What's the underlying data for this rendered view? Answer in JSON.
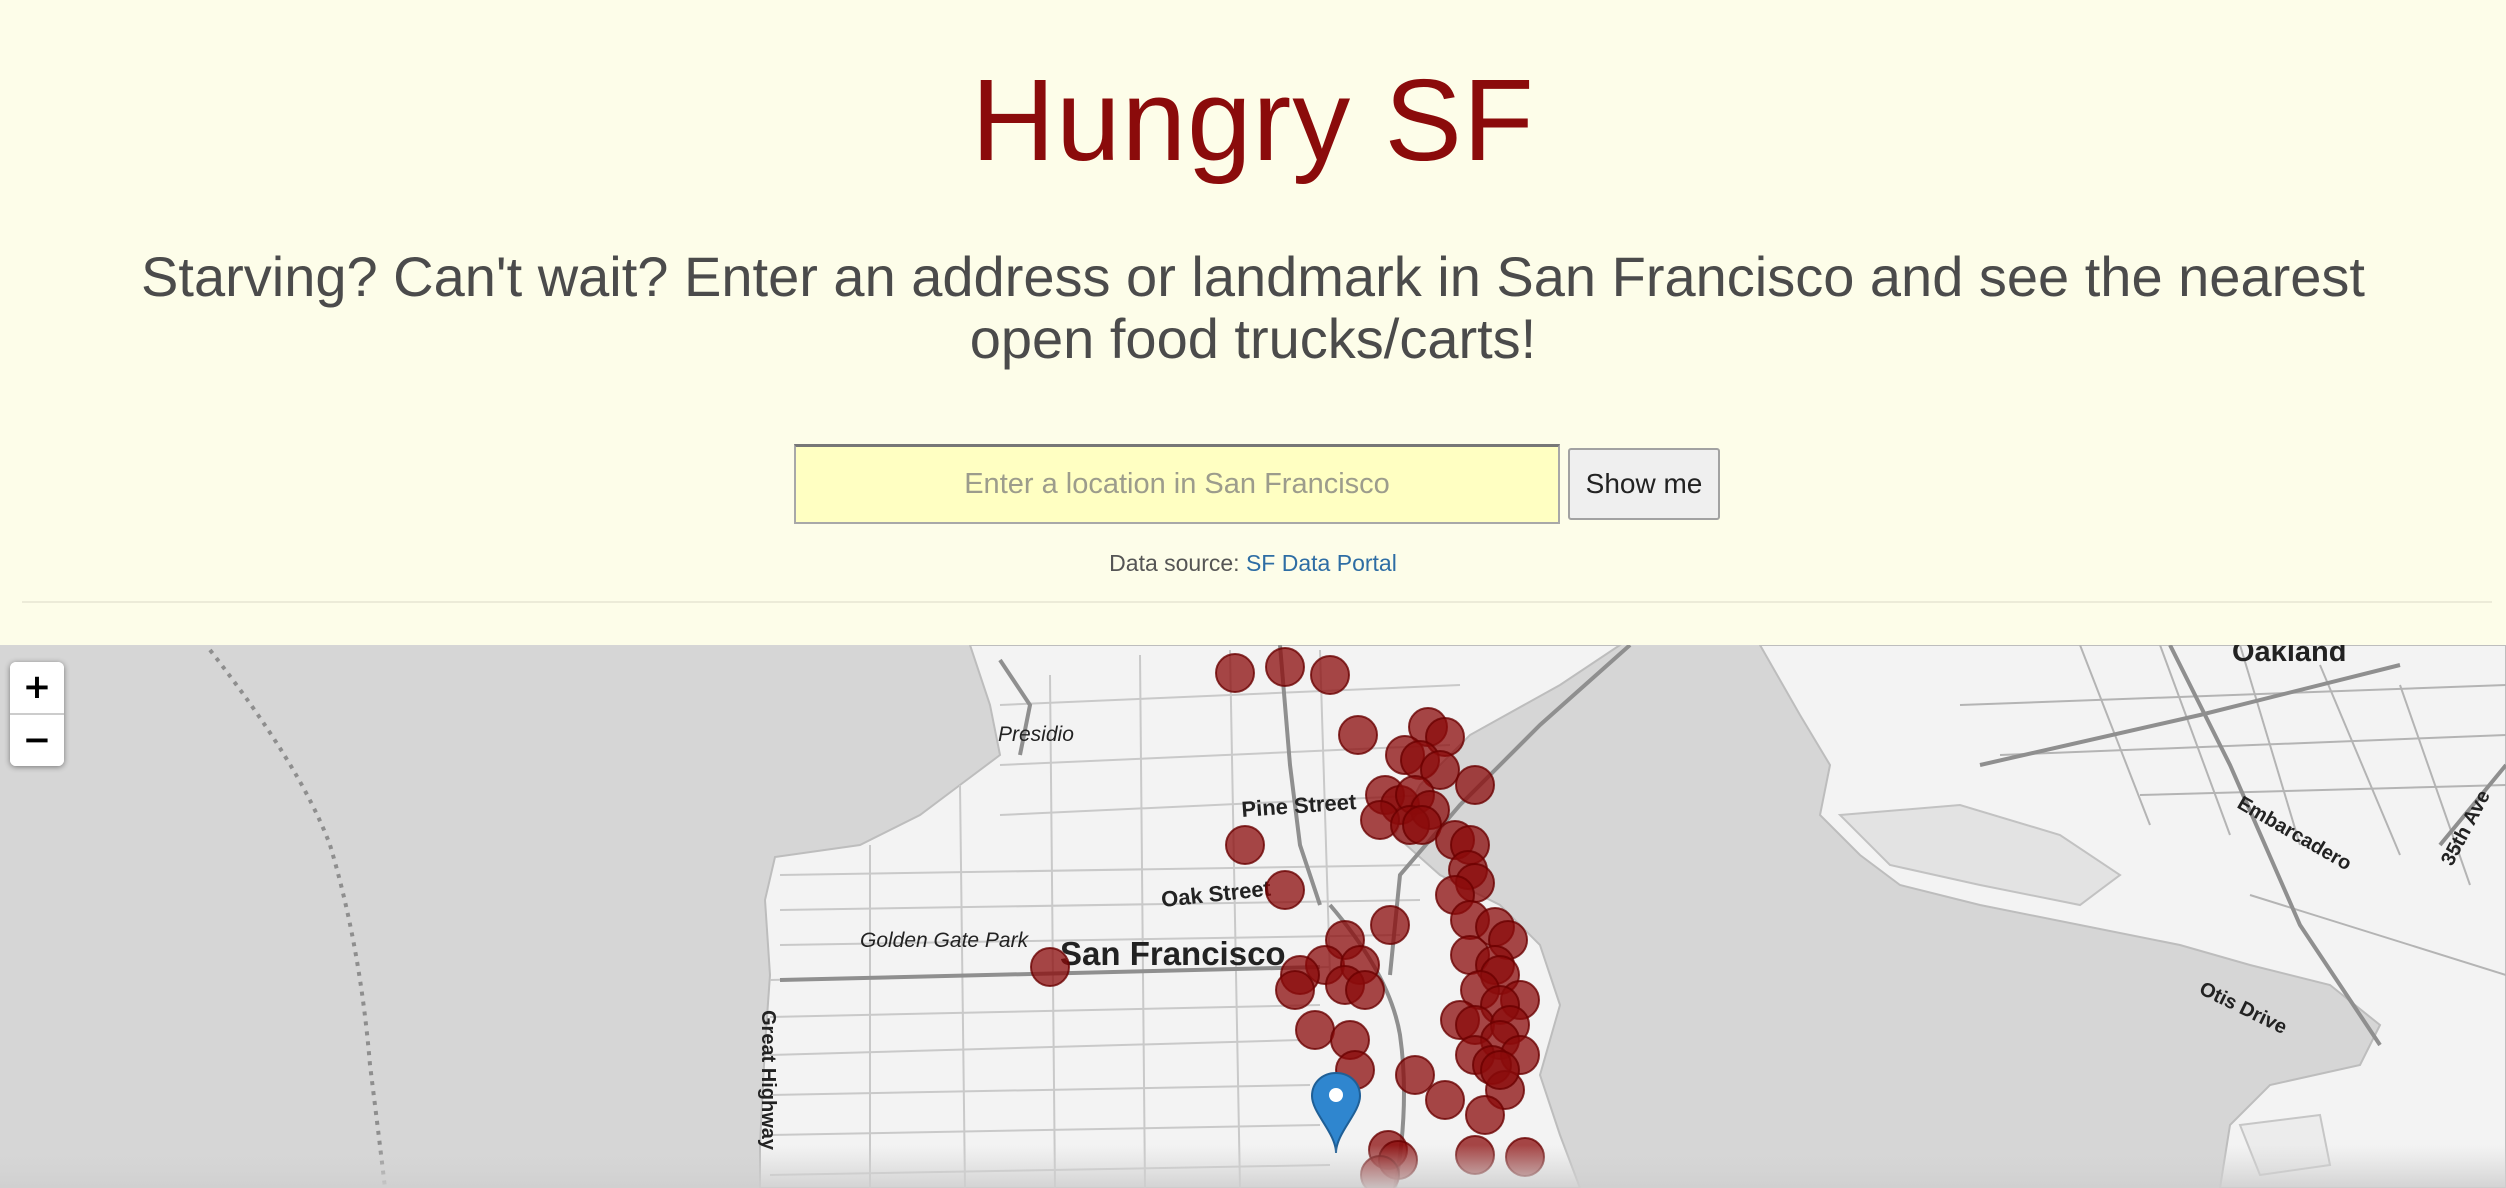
{
  "header": {
    "title": "Hungry SF",
    "subtitle": "Starving? Can't wait? Enter an address or landmark in San Francisco and see the nearest open food trucks/carts!",
    "search": {
      "placeholder": "Enter a location in San Francisco",
      "value": "",
      "button_label": "Show me"
    },
    "data_source": {
      "label": "Data source:",
      "link_text": "SF Data Portal"
    }
  },
  "colors": {
    "title": "#8b0b0b",
    "page_background": "#fdfde9",
    "input_background": "#ffffc2",
    "marker_fill": "#8b0b0b",
    "pin": "#2f86cf",
    "link": "#2e6da4"
  },
  "map": {
    "zoom_in_label": "+",
    "zoom_out_label": "−",
    "labels": {
      "presidio": "Presidio",
      "pine_street": "Pine Street",
      "oak_street": "Oak Street",
      "golden_gate_park": "Golden Gate Park",
      "san_francisco": "San Francisco",
      "great_highway": "Great Highway",
      "oakland": "Oakland",
      "embarcadero": "Embarcadero",
      "ave_35th": "35th Ave",
      "otis_drive": "Otis Drive"
    },
    "user_location_icon": "map-pin-icon",
    "food_truck_marker_count": 62
  }
}
